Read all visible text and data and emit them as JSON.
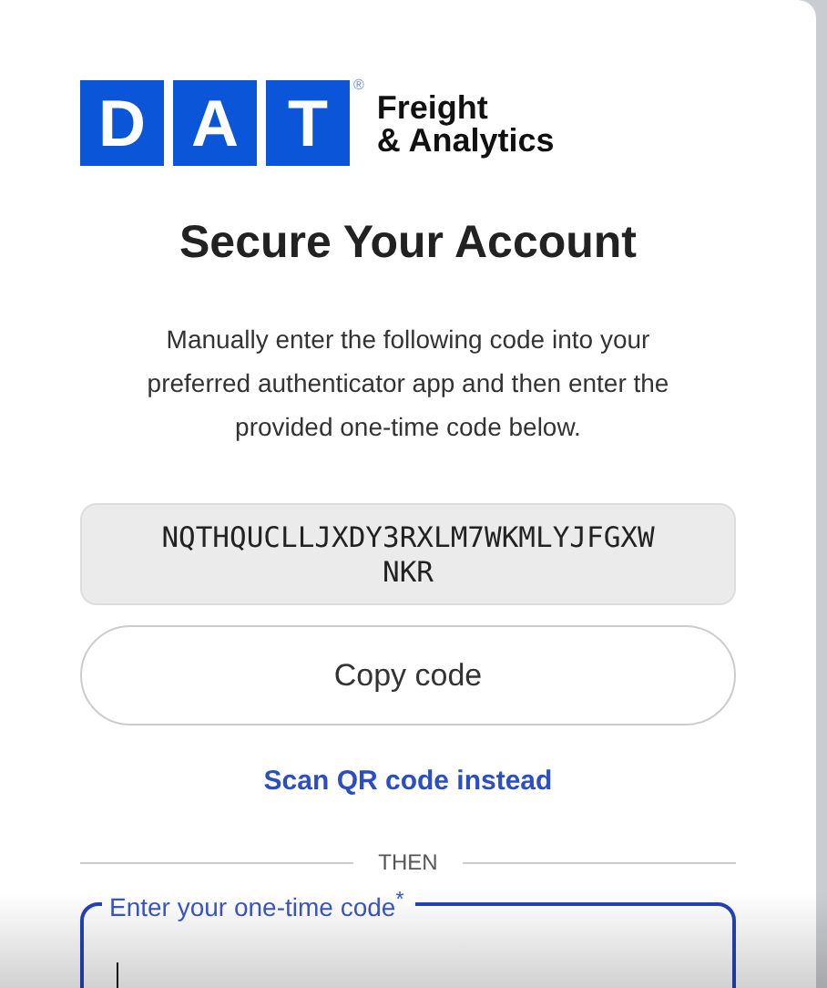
{
  "logo": {
    "letters": [
      "D",
      "A",
      "T"
    ],
    "mark": "®",
    "tagline": [
      "Freight",
      "& Analytics"
    ]
  },
  "title": "Secure Your Account",
  "instructions": "Manually enter the following code into your preferred authenticator app and then enter the provided one-time code below.",
  "secret_code": "NQTHQUCLLJXDY3RXLM7WKMLYJFGXWNKR",
  "copy_button": "Copy code",
  "qr_link": "Scan QR code instead",
  "divider": "THEN",
  "code_field": {
    "label": "Enter your one-time code$^{*}$",
    "focused": true
  }
}
